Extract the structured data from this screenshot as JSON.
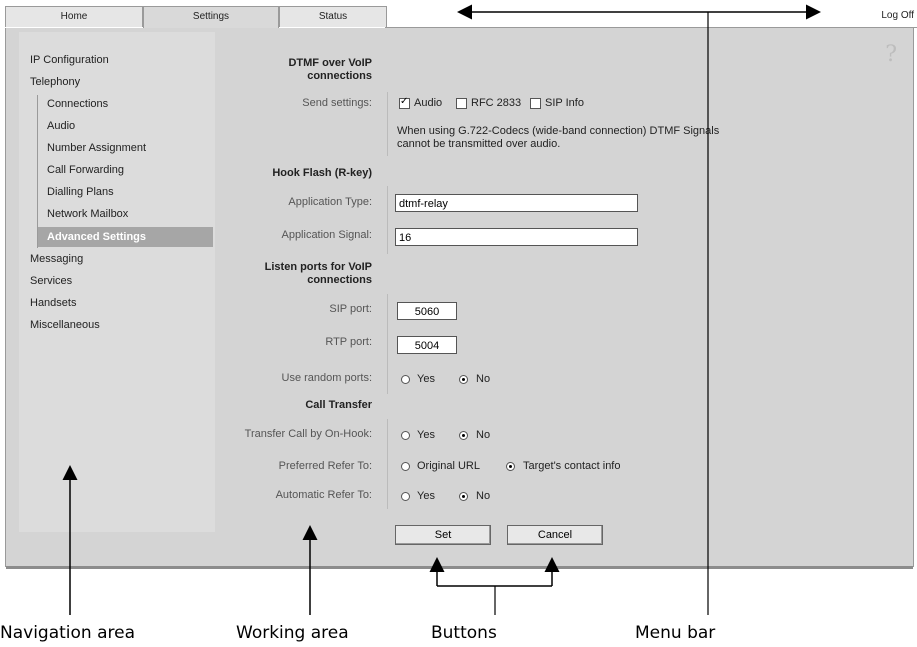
{
  "tabs": {
    "home": "Home",
    "settings": "Settings",
    "status": "Status"
  },
  "logoff": "Log Off",
  "nav": {
    "items": [
      "IP Configuration",
      "Telephony"
    ],
    "telephony_sub": [
      "Connections",
      "Audio",
      "Number Assignment",
      "Call Forwarding",
      "Dialling Plans",
      "Network Mailbox",
      "Advanced Settings"
    ],
    "items_after": [
      "Messaging",
      "Services",
      "Handsets",
      "Miscellaneous"
    ]
  },
  "work": {
    "dtmf_section": "DTMF over VoIP connections",
    "send_settings_label": "Send settings:",
    "send_options": [
      "Audio",
      "RFC 2833",
      "SIP Info"
    ],
    "send_checked": [
      true,
      false,
      false
    ],
    "dtmf_note": "When using G.722-Codecs (wide-band connection) DTMF Signals cannot be transmitted over audio.",
    "hook_flash_section": "Hook Flash (R-key)",
    "app_type_label": "Application Type:",
    "app_type_value": "dtmf-relay",
    "app_signal_label": "Application Signal:",
    "app_signal_value": "16",
    "listen_ports_section": "Listen ports for VoIP connections",
    "sip_port_label": "SIP port:",
    "sip_port_value": "5060",
    "rtp_port_label": "RTP port:",
    "rtp_port_value": "5004",
    "random_ports_label": "Use random ports:",
    "yes": "Yes",
    "no": "No",
    "call_transfer_section": "Call Transfer",
    "transfer_onhook_label": "Transfer Call by On-Hook:",
    "preferred_refer_label": "Preferred Refer To:",
    "preferred_refer_options": [
      "Original URL",
      "Target's contact info"
    ],
    "automatic_refer_label": "Automatic Refer To:",
    "set_button": "Set",
    "cancel_button": "Cancel"
  },
  "help_icon": "?",
  "annotations": {
    "navigation_area": "Navigation area",
    "working_area": "Working area",
    "buttons": "Buttons",
    "menu_bar": "Menu bar"
  }
}
